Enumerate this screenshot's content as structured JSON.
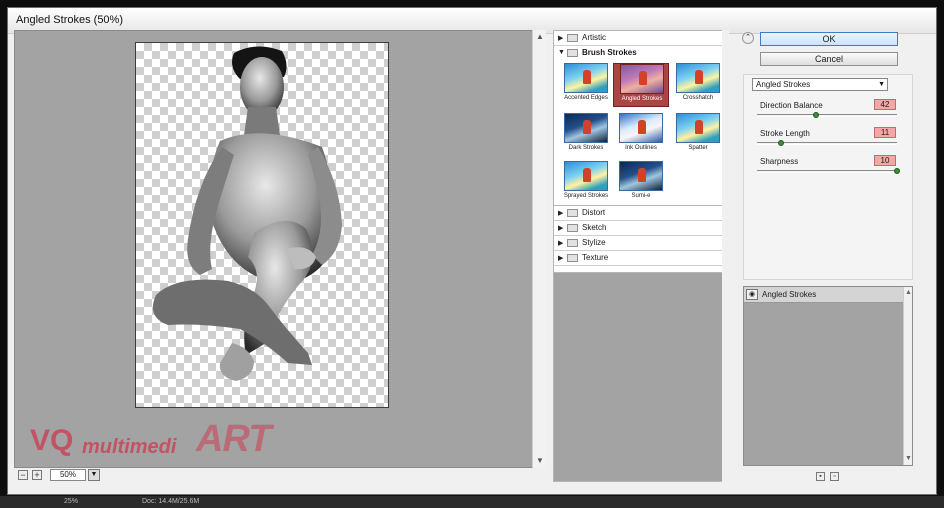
{
  "window": {
    "title": "Angled Strokes (50%)"
  },
  "preview": {
    "zoom": "50%",
    "zoom_out": "−",
    "zoom_in": "+"
  },
  "gallery": {
    "categories_top": [
      {
        "label": "Artistic",
        "expanded": false
      },
      {
        "label": "Brush Strokes",
        "expanded": true
      }
    ],
    "thumbnails": [
      {
        "label": "Accented Edges",
        "selected": false
      },
      {
        "label": "Angled Strokes",
        "selected": true
      },
      {
        "label": "Crosshatch",
        "selected": false
      },
      {
        "label": "Dark Strokes",
        "selected": false
      },
      {
        "label": "Ink Outlines",
        "selected": false
      },
      {
        "label": "Spatter",
        "selected": false
      },
      {
        "label": "Sprayed Strokes",
        "selected": false
      },
      {
        "label": "Sumi-e",
        "selected": false
      }
    ],
    "categories_bottom": [
      {
        "label": "Distort"
      },
      {
        "label": "Sketch"
      },
      {
        "label": "Stylize"
      },
      {
        "label": "Texture"
      }
    ]
  },
  "buttons": {
    "ok": "OK",
    "cancel": "Cancel"
  },
  "settings": {
    "filter": "Angled Strokes",
    "params": [
      {
        "label": "Direction Balance",
        "value": "42",
        "min": 0,
        "max": 100
      },
      {
        "label": "Stroke Length",
        "value": "11",
        "min": 3,
        "max": 50
      },
      {
        "label": "Sharpness",
        "value": "10",
        "min": 0,
        "max": 10
      }
    ]
  },
  "layers": {
    "items": [
      {
        "label": "Angled Strokes"
      }
    ]
  },
  "status": {
    "zoom": "25%",
    "doc": "Doc: 14.4M/25.6M"
  },
  "watermark": {
    "text1": "VQ",
    "text2": "multimedi",
    "text3": "ART"
  },
  "colors": {
    "selection": "#a94545",
    "param_value_bg": "#f4a7a7",
    "ok_border": "#3b7cc4"
  }
}
